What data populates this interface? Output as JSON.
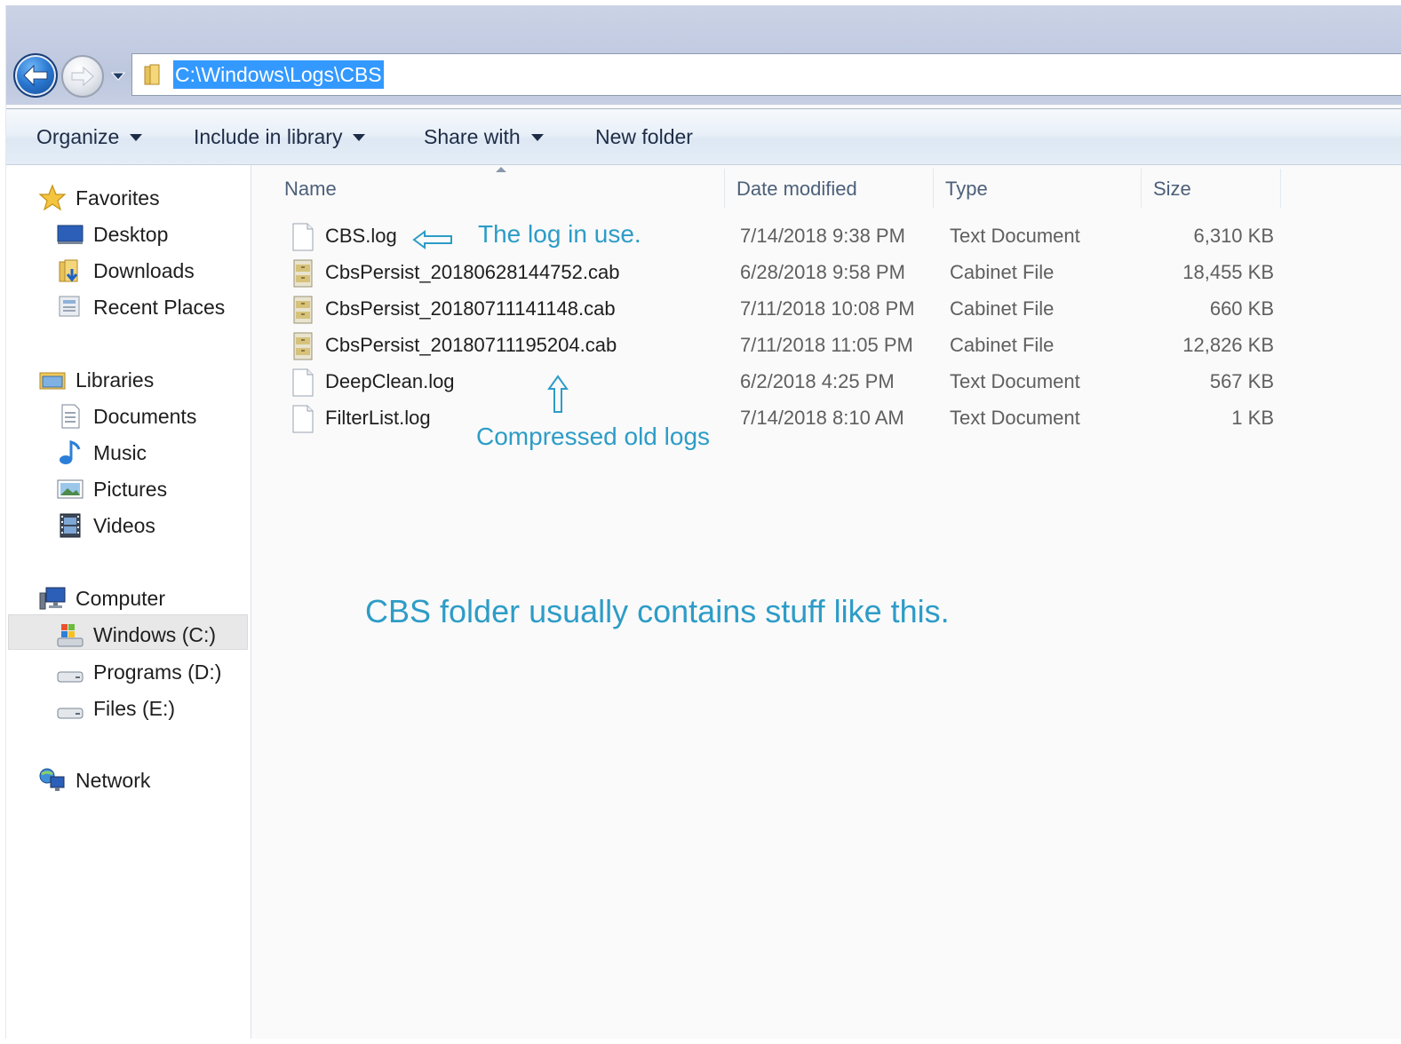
{
  "address": {
    "path": "C:\\Windows\\Logs\\CBS"
  },
  "toolbar": {
    "organize": "Organize",
    "include_in_library": "Include in library",
    "share_with": "Share with",
    "new_folder": "New folder"
  },
  "nav": {
    "favorites": "Favorites",
    "desktop": "Desktop",
    "downloads": "Downloads",
    "recent_places": "Recent Places",
    "libraries": "Libraries",
    "documents": "Documents",
    "music": "Music",
    "pictures": "Pictures",
    "videos": "Videos",
    "computer": "Computer",
    "windows_c": "Windows (C:)",
    "programs_d": "Programs (D:)",
    "files_e": "Files (E:)",
    "network": "Network"
  },
  "columns": {
    "name": "Name",
    "date_modified": "Date modified",
    "type": "Type",
    "size": "Size"
  },
  "files": [
    {
      "name": "CBS.log",
      "date": "7/14/2018 9:38 PM",
      "type": "Text Document",
      "size": "6,310 KB",
      "icon": "text-document-icon"
    },
    {
      "name": "CbsPersist_20180628144752.cab",
      "date": "6/28/2018 9:58 PM",
      "type": "Cabinet File",
      "size": "18,455 KB",
      "icon": "cabinet-file-icon"
    },
    {
      "name": "CbsPersist_20180711141148.cab",
      "date": "7/11/2018 10:08 PM",
      "type": "Cabinet File",
      "size": "660 KB",
      "icon": "cabinet-file-icon"
    },
    {
      "name": "CbsPersist_20180711195204.cab",
      "date": "7/11/2018 11:05 PM",
      "type": "Cabinet File",
      "size": "12,826 KB",
      "icon": "cabinet-file-icon"
    },
    {
      "name": "DeepClean.log",
      "date": "6/2/2018 4:25 PM",
      "type": "Text Document",
      "size": "567 KB",
      "icon": "text-document-icon"
    },
    {
      "name": "FilterList.log",
      "date": "7/14/2018 8:10 AM",
      "type": "Text Document",
      "size": "1 KB",
      "icon": "text-document-icon"
    }
  ],
  "annotations": {
    "log_in_use": "The log in use.",
    "compressed_old_logs": "Compressed old logs",
    "cbs_folder_note": "CBS folder usually contains stuff like this."
  },
  "colors": {
    "annotation": "#2d9cc7",
    "address_highlight": "#3399ff"
  }
}
